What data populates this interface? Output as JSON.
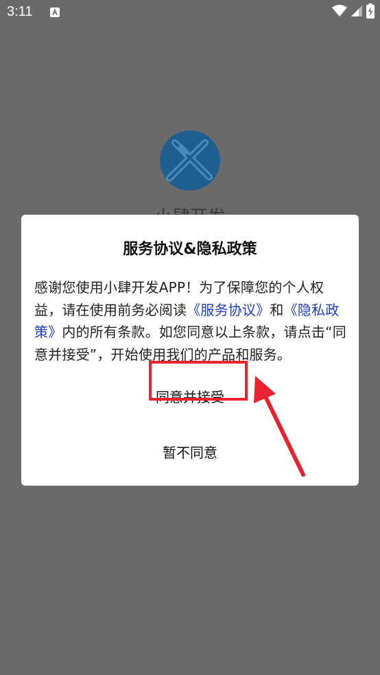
{
  "status_bar": {
    "time": "3:11",
    "icons": [
      "notification-a-icon",
      "wifi-icon",
      "signal-icon",
      "battery-icon"
    ]
  },
  "background_app": {
    "name": "小肆开发"
  },
  "dialog": {
    "title": "服务协议&隐私政策",
    "body": {
      "part1": "感谢您使用小肆开发APP！为了保障您的个人权益，请在使用前务必阅读",
      "link_service": "《服务协议》",
      "part2": "和",
      "link_privacy": "《隐私政策》",
      "part3": "内的所有条款。如您同意以上条款，请点击“同意并接受”，开始使用我们的产品和服务。"
    },
    "accept_label": "同意并接受",
    "reject_label": "暂不同意"
  },
  "colors": {
    "overlay": "#6a6a6a",
    "dialog_bg": "#ffffff",
    "link": "#1c3fbf",
    "annotation": "#e8222e",
    "logo": "#1f5f8f"
  }
}
